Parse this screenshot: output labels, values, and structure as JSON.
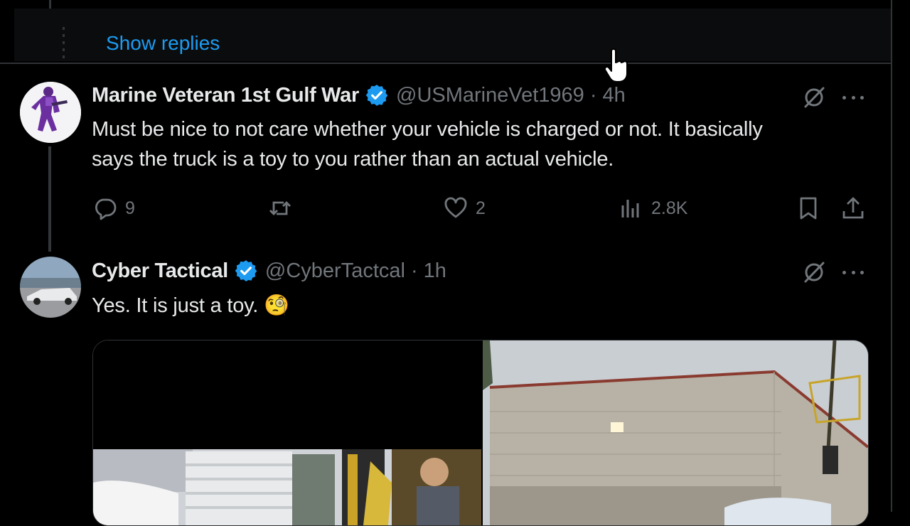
{
  "thread": {
    "show_replies_label": "Show replies"
  },
  "tweets": [
    {
      "name": "Marine Veteran 1st Gulf War",
      "handle": "@USMarineVet1969",
      "separator": "·",
      "time": "4h",
      "text_line1": "Must be nice to not care whether your vehicle is charged or not. It basically",
      "text_line2": "says the truck is a toy to you rather than an actual vehicle.",
      "replies": "9",
      "reposts": "",
      "likes": "2",
      "views": "2.8K"
    },
    {
      "name": "Cyber Tactical",
      "handle": "@CyberTactcal",
      "separator": "·",
      "time": "1h",
      "text": "Yes. It is just a toy. 🧐"
    }
  ],
  "colors": {
    "accent": "#1d9bf0",
    "muted": "#71767b",
    "text": "#e7e9ea",
    "border": "#2f3336",
    "background": "#000000"
  },
  "icons": [
    "verified-badge-icon",
    "grok-icon",
    "more-icon",
    "reply-icon",
    "repost-icon",
    "like-icon",
    "views-icon",
    "bookmark-icon",
    "share-icon",
    "hand-cursor-icon"
  ]
}
